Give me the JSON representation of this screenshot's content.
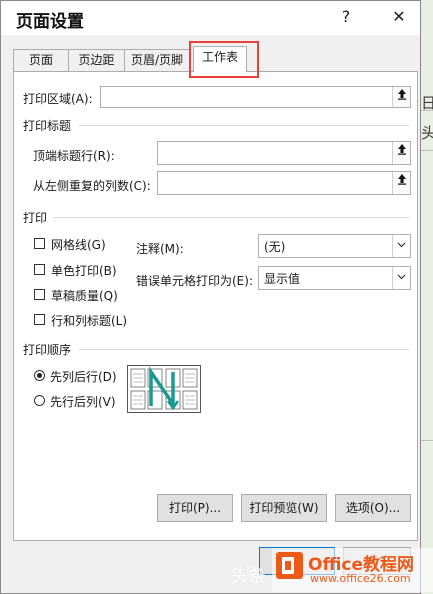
{
  "background": {
    "right_text_1": "日",
    "right_text_2": "头"
  },
  "dialog": {
    "title": "页面设置",
    "help_glyph": "?",
    "close_glyph": "✕"
  },
  "tabs": [
    {
      "label": "页面"
    },
    {
      "label": "页边距"
    },
    {
      "label": "页眉/页脚"
    },
    {
      "label": "工作表"
    }
  ],
  "print_area": {
    "label": "打印区域(A):",
    "value": ""
  },
  "print_titles": {
    "section_label": "打印标题",
    "top_rows_label": "顶端标题行(R):",
    "top_rows_value": "",
    "left_cols_label": "从左侧重复的列数(C):",
    "left_cols_value": ""
  },
  "print": {
    "section_label": "打印",
    "gridlines": {
      "label": "网格线(G)",
      "checked": false
    },
    "mono": {
      "label": "单色打印(B)",
      "checked": false
    },
    "draft": {
      "label": "草稿质量(Q)",
      "checked": false
    },
    "headings": {
      "label": "行和列标题(L)",
      "checked": false
    },
    "comments_label": "注释(M):",
    "comments_value": "(无)",
    "errors_label": "错误单元格打印为(E):",
    "errors_value": "显示值"
  },
  "page_order": {
    "section_label": "打印顺序",
    "down_then_over": {
      "label": "先列后行(D)",
      "selected": true
    },
    "over_then_down": {
      "label": "先行后列(V)",
      "selected": false
    }
  },
  "buttons": {
    "print": "打印(P)...",
    "preview": "打印预览(W)",
    "options": "选项(O)..."
  },
  "watermark": {
    "left_text": "头条",
    "brand": "Office教程网",
    "url": "www.office26.com"
  },
  "colors": {
    "highlight": "#e8403b",
    "accent_teal": "#1a9a92",
    "logo_orange": "#eb5a18"
  }
}
